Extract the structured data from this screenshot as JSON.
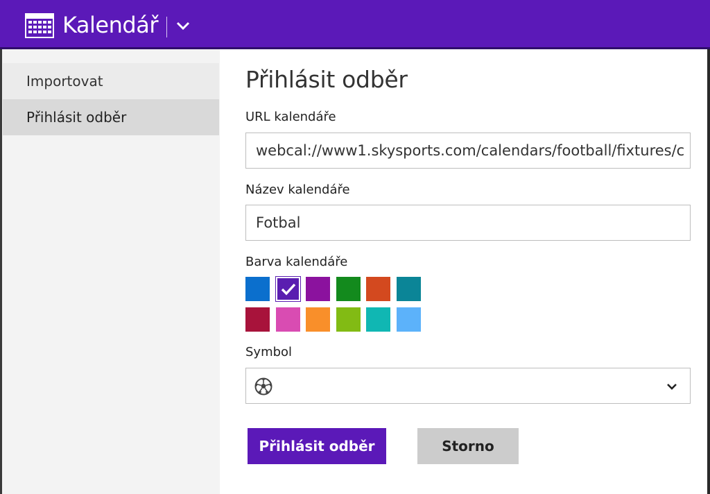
{
  "header": {
    "title": "Kalendář",
    "bg_color": "#5b19b8"
  },
  "sidebar": {
    "items": [
      {
        "label": "Importovat"
      },
      {
        "label": "Přihlásit odběr"
      }
    ]
  },
  "form": {
    "title": "Přihlásit odběr",
    "url_label": "URL kalendáře",
    "url_value": "webcal://www1.skysports.com/calendars/football/fixtures/c",
    "name_label": "Název kalendáře",
    "name_value": "Fotbal",
    "color_label": "Barva kalendáře",
    "colors": [
      "#0b6fcd",
      "#5a1eb0",
      "#8b129e",
      "#138a1d",
      "#d3491f",
      "#0b8597",
      "#a8133b",
      "#d94cb2",
      "#f98f2a",
      "#82bb14",
      "#10b7b3",
      "#5cb2fa"
    ],
    "selected_color_index": 1,
    "symbol_label": "Symbol",
    "symbol_icon": "soccer-ball-icon"
  },
  "buttons": {
    "subscribe": "Přihlásit odběr",
    "cancel": "Storno"
  }
}
